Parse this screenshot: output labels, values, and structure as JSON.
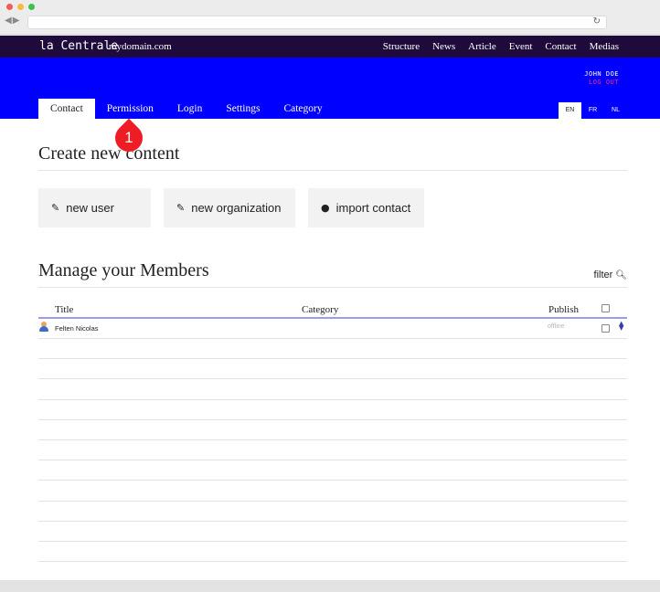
{
  "site": {
    "brand": "la Centrale",
    "domain": "mydomain.com",
    "top_nav": [
      "Structure",
      "News",
      "Article",
      "Event",
      "Contact",
      "Medias"
    ]
  },
  "user": {
    "name": "JOHN DOE",
    "logout": "LOG OUT"
  },
  "tabs": [
    "Contact",
    "Permission",
    "Login",
    "Settings",
    "Category"
  ],
  "languages": [
    "EN",
    "FR",
    "NL"
  ],
  "marker": {
    "number": "1"
  },
  "create_section": {
    "title": "Create new content",
    "buttons": [
      {
        "label": "new user",
        "icon": "pencil-icon"
      },
      {
        "label": "new organization",
        "icon": "pencil-icon"
      },
      {
        "label": "import contact",
        "icon": "download-circle-icon"
      }
    ]
  },
  "members_section": {
    "title": "Manage your Members",
    "filter_label": "filter",
    "columns": [
      "Title",
      "Category",
      "Publish"
    ],
    "rows": [
      {
        "name": "Felten Nicolas",
        "category": "",
        "status": "offline"
      }
    ]
  },
  "colors": {
    "topbar": "#1f0a3c",
    "band": "#0000ff",
    "accent": "#ff2a7a",
    "marker": "#ee1c24"
  }
}
